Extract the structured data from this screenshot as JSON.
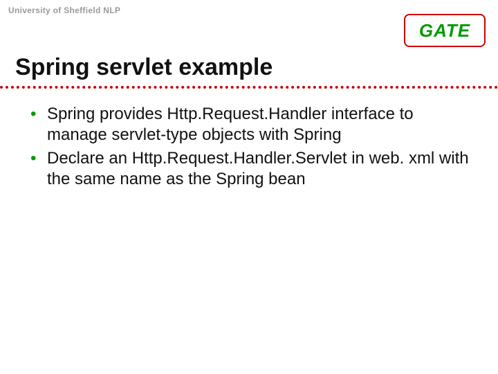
{
  "header": "University of Sheffield NLP",
  "logo": "GATE",
  "title": "Spring servlet example",
  "bullets": [
    "Spring provides Http.Request.Handler interface to manage servlet-type objects with Spring",
    "Declare an Http.Request.Handler.Servlet in web. xml with the same name as the Spring bean"
  ]
}
